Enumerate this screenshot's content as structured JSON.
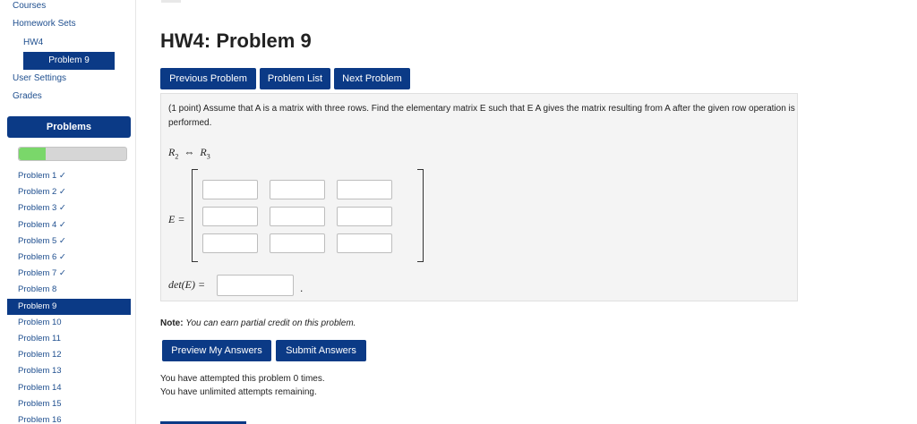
{
  "nav": {
    "courses": "Courses",
    "homework_sets": "Homework Sets",
    "hw4": "HW4",
    "problem9": "Problem 9",
    "user_settings": "User Settings",
    "grades": "Grades"
  },
  "problems_panel": {
    "header": "Problems",
    "progress_fraction": 0.25,
    "items": [
      "Problem 1 ✓",
      "Problem 2 ✓",
      "Problem 3 ✓",
      "Problem 4 ✓",
      "Problem 5 ✓",
      "Problem 6 ✓",
      "Problem 7 ✓",
      "Problem 8",
      "Problem 9",
      "Problem 10",
      "Problem 11",
      "Problem 12",
      "Problem 13",
      "Problem 14",
      "Problem 15",
      "Problem 16"
    ],
    "active_item": "Problem 9"
  },
  "main": {
    "title": "HW4: Problem 9",
    "buttons": {
      "previous": "Previous Problem",
      "list": "Problem List",
      "next": "Next Problem"
    },
    "problem": {
      "statement": "(1 point) Assume that A is a matrix with three rows. Find the elementary matrix E such that E A gives the matrix resulting from A after the given row operation is performed.",
      "row_op_left": "R",
      "row_op_left_sub": "2",
      "row_op_arrow": "⇔",
      "row_op_right": "R",
      "row_op_right_sub": "3",
      "e_label": "E =",
      "det_label": "det(E) =",
      "det_trailing": "."
    },
    "note_bold": "Note:",
    "note_text": "You can earn partial credit on this problem.",
    "actions": {
      "preview": "Preview My Answers",
      "submit": "Submit Answers"
    },
    "attempts_line": "You have attempted this problem 0 times.",
    "remaining_line": "You have unlimited attempts remaining."
  },
  "colors": {
    "accent": "#0b3a86",
    "progress": "#7ad76a"
  }
}
